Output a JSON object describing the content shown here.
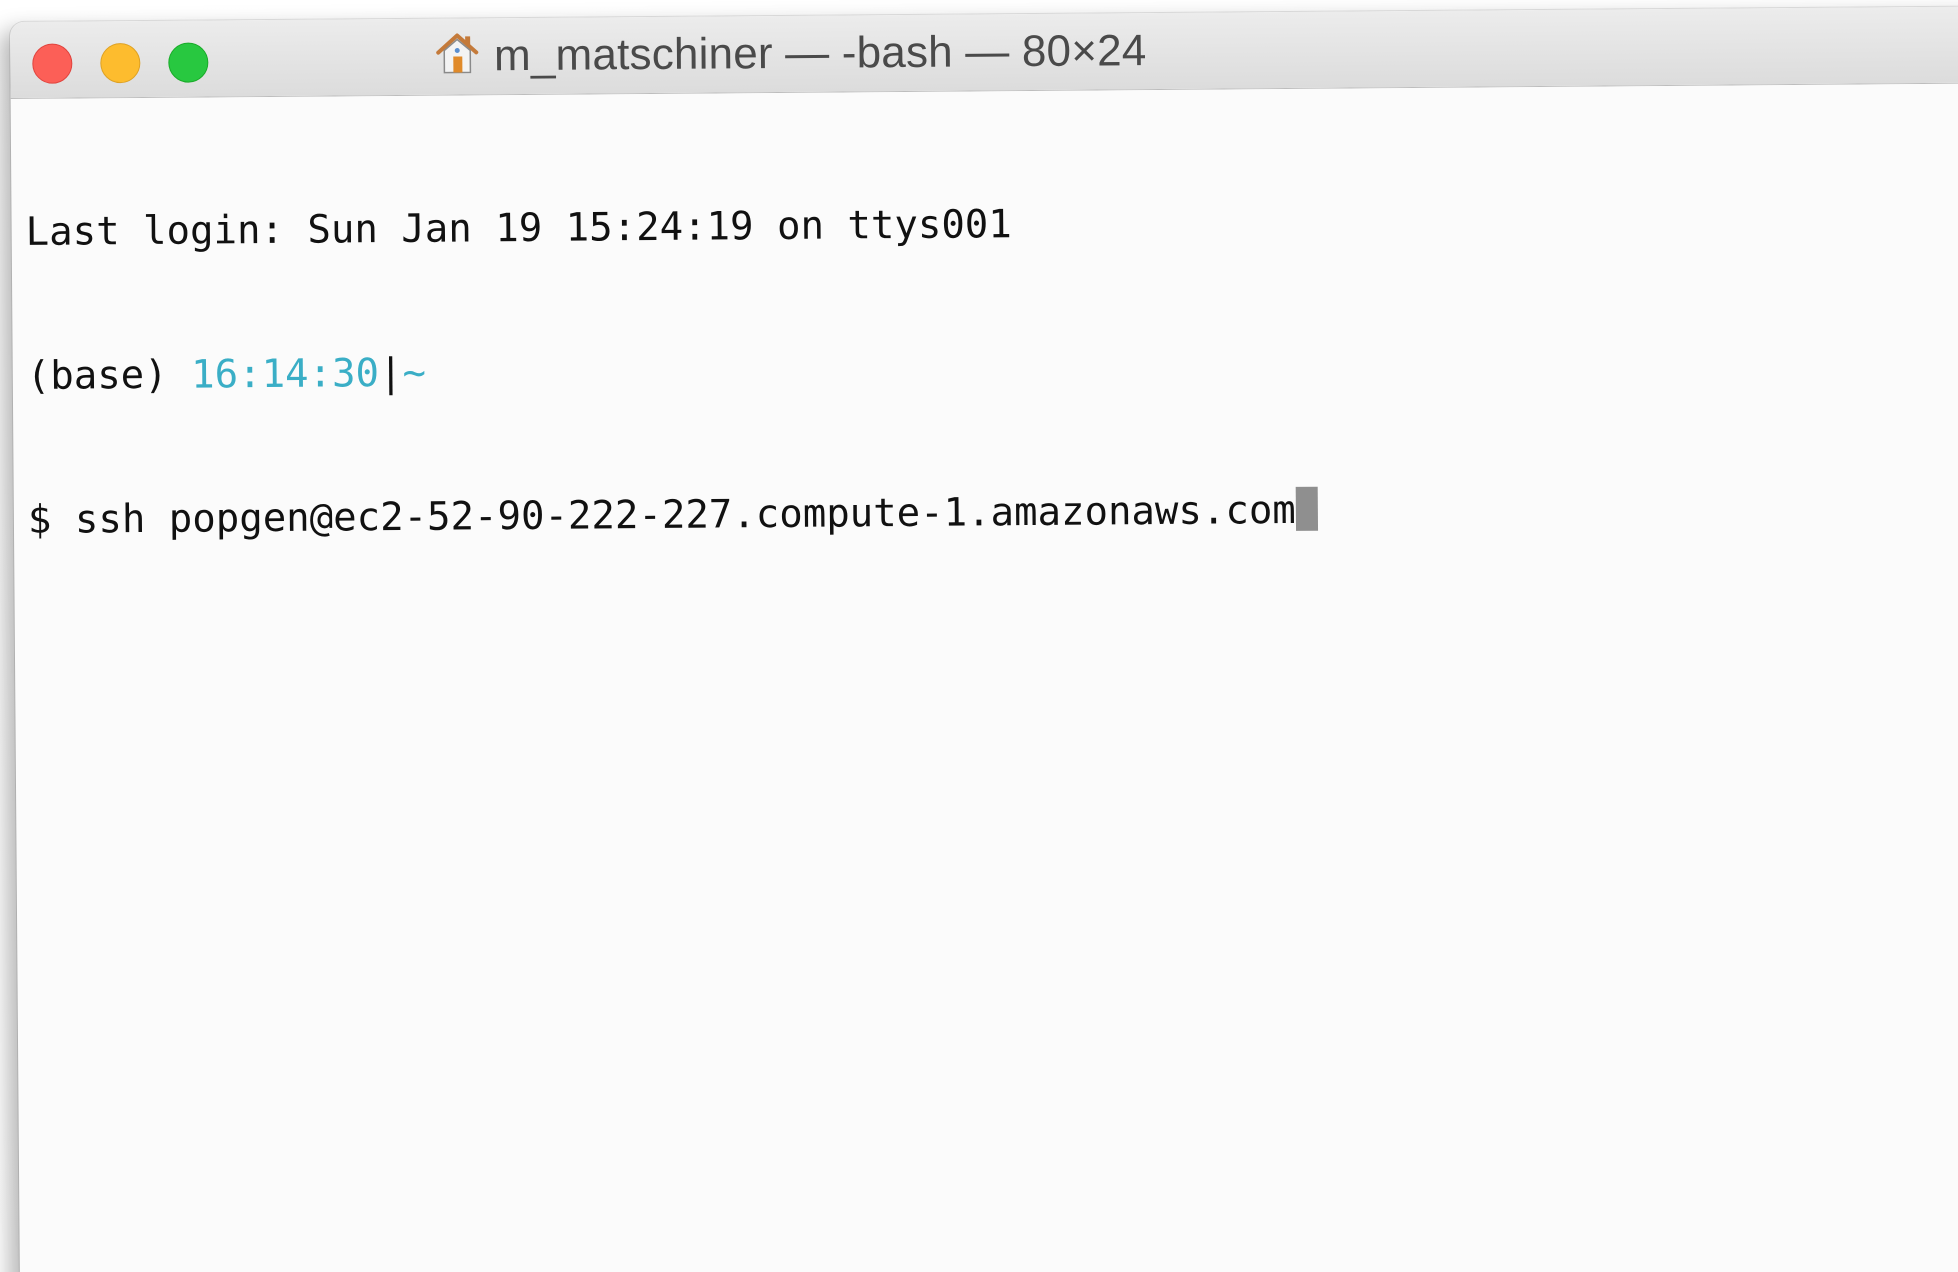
{
  "window": {
    "title": "m_matschiner — -bash — 80×24",
    "title_icon": "home-icon",
    "traffic_lights": {
      "close_color": "#fc5f57",
      "minimize_color": "#fdbc2e",
      "zoom_color": "#28c840"
    }
  },
  "terminal": {
    "last_login": "Last login: Sun Jan 19 15:24:19 on ttys001",
    "prompt": {
      "env": "(base) ",
      "time": "16:14:30",
      "separator": "|",
      "cwd": "~",
      "time_color": "#3aaec6"
    },
    "command_line": {
      "symbol": "$ ",
      "command": "ssh popgen@ec2-52-90-222-227.compute-1.amazonaws.com"
    }
  }
}
